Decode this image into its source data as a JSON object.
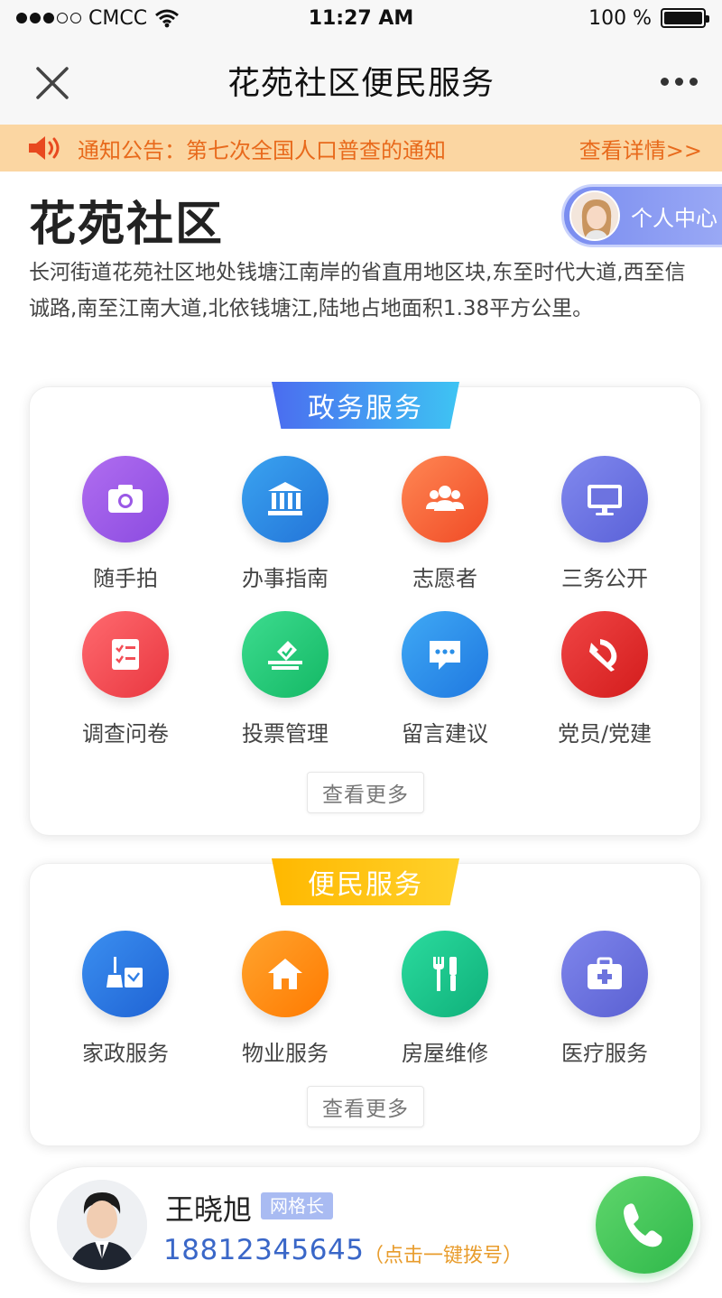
{
  "status_bar": {
    "carrier": "CMCC",
    "time": "11:27 AM",
    "battery": "100 %"
  },
  "nav": {
    "title": "花苑社区便民服务"
  },
  "notice": {
    "label": "通知公告：",
    "text": "第七次全国人口普查的通知",
    "link": "查看详情>>"
  },
  "header": {
    "title": "花苑社区",
    "personal_center": "个人中心",
    "description": "长河街道花苑社区地处钱塘江南岸的省直用地区块,东至时代大道,西至信诚路,南至江南大道,北依钱塘江,陆地占地面积1.38平方公里。"
  },
  "gov_services": {
    "title": "政务服务",
    "items": [
      {
        "label": "随手拍",
        "icon": "camera-icon",
        "color": "#a25be8"
      },
      {
        "label": "办事指南",
        "icon": "government-building-icon",
        "color": "#2f8de4"
      },
      {
        "label": "志愿者",
        "icon": "people-group-icon",
        "color": "#f5683a"
      },
      {
        "label": "三务公开",
        "icon": "monitor-icon",
        "color": "#6d73e0"
      },
      {
        "label": "调查问卷",
        "icon": "checklist-icon",
        "color": "#f24f57"
      },
      {
        "label": "投票管理",
        "icon": "ballot-box-icon",
        "color": "#20c777"
      },
      {
        "label": "留言建议",
        "icon": "chat-bubble-icon",
        "color": "#2a8fe8"
      },
      {
        "label": "党员/党建",
        "icon": "party-emblem-icon",
        "color": "#e62b2b"
      }
    ],
    "more": "查看更多"
  },
  "civil_services": {
    "title": "便民服务",
    "items": [
      {
        "label": "家政服务",
        "icon": "cleaning-icon",
        "color": "#2f7fe6"
      },
      {
        "label": "物业服务",
        "icon": "house-icon",
        "color": "#ff8a14"
      },
      {
        "label": "房屋维修",
        "icon": "repair-tools-icon",
        "color": "#18c58a"
      },
      {
        "label": "医疗服务",
        "icon": "medical-kit-icon",
        "color": "#6c73dd"
      }
    ],
    "more": "查看更多"
  },
  "contact": {
    "name": "王晓旭",
    "badge": "网格长",
    "phone": "18812345645",
    "hint": "（点击一键拨号）"
  }
}
